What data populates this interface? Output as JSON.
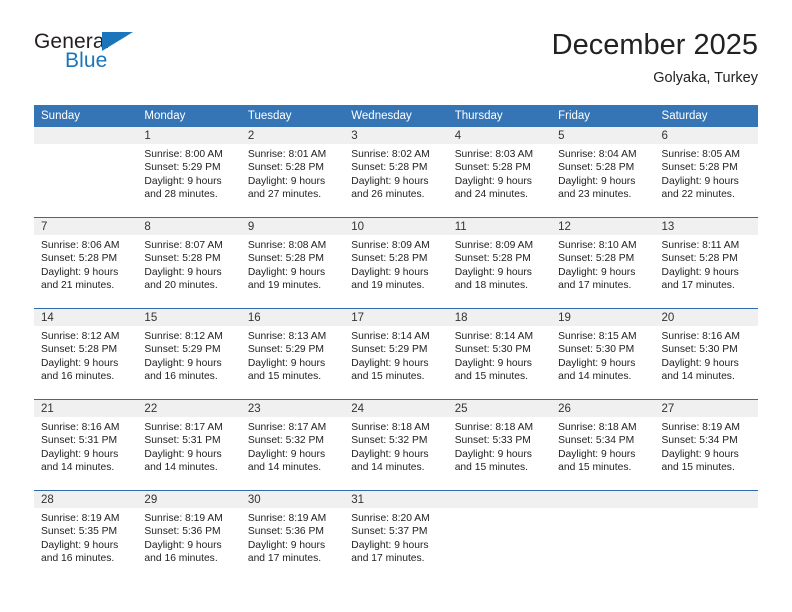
{
  "logo": {
    "word_one": "General",
    "word_two": "Blue",
    "flag_icon": "triangle-flag-icon"
  },
  "header": {
    "title": "December 2025",
    "subtitle": "Golyaka, Turkey"
  },
  "colors": {
    "header_blue": "#3575b5",
    "week_divider_blue": "#2d6cae",
    "daynum_band": "#f0f0f0",
    "logo_blue": "#1b75bb",
    "text": "#222222"
  },
  "calendar": {
    "weekday_headers": [
      "Sunday",
      "Monday",
      "Tuesday",
      "Wednesday",
      "Thursday",
      "Friday",
      "Saturday"
    ],
    "weeks": [
      [
        {
          "day": "",
          "lines": []
        },
        {
          "day": "1",
          "lines": [
            "Sunrise: 8:00 AM",
            "Sunset: 5:29 PM",
            "Daylight: 9 hours",
            "and 28 minutes."
          ]
        },
        {
          "day": "2",
          "lines": [
            "Sunrise: 8:01 AM",
            "Sunset: 5:28 PM",
            "Daylight: 9 hours",
            "and 27 minutes."
          ]
        },
        {
          "day": "3",
          "lines": [
            "Sunrise: 8:02 AM",
            "Sunset: 5:28 PM",
            "Daylight: 9 hours",
            "and 26 minutes."
          ]
        },
        {
          "day": "4",
          "lines": [
            "Sunrise: 8:03 AM",
            "Sunset: 5:28 PM",
            "Daylight: 9 hours",
            "and 24 minutes."
          ]
        },
        {
          "day": "5",
          "lines": [
            "Sunrise: 8:04 AM",
            "Sunset: 5:28 PM",
            "Daylight: 9 hours",
            "and 23 minutes."
          ]
        },
        {
          "day": "6",
          "lines": [
            "Sunrise: 8:05 AM",
            "Sunset: 5:28 PM",
            "Daylight: 9 hours",
            "and 22 minutes."
          ]
        }
      ],
      [
        {
          "day": "7",
          "lines": [
            "Sunrise: 8:06 AM",
            "Sunset: 5:28 PM",
            "Daylight: 9 hours",
            "and 21 minutes."
          ]
        },
        {
          "day": "8",
          "lines": [
            "Sunrise: 8:07 AM",
            "Sunset: 5:28 PM",
            "Daylight: 9 hours",
            "and 20 minutes."
          ]
        },
        {
          "day": "9",
          "lines": [
            "Sunrise: 8:08 AM",
            "Sunset: 5:28 PM",
            "Daylight: 9 hours",
            "and 19 minutes."
          ]
        },
        {
          "day": "10",
          "lines": [
            "Sunrise: 8:09 AM",
            "Sunset: 5:28 PM",
            "Daylight: 9 hours",
            "and 19 minutes."
          ]
        },
        {
          "day": "11",
          "lines": [
            "Sunrise: 8:09 AM",
            "Sunset: 5:28 PM",
            "Daylight: 9 hours",
            "and 18 minutes."
          ]
        },
        {
          "day": "12",
          "lines": [
            "Sunrise: 8:10 AM",
            "Sunset: 5:28 PM",
            "Daylight: 9 hours",
            "and 17 minutes."
          ]
        },
        {
          "day": "13",
          "lines": [
            "Sunrise: 8:11 AM",
            "Sunset: 5:28 PM",
            "Daylight: 9 hours",
            "and 17 minutes."
          ]
        }
      ],
      [
        {
          "day": "14",
          "lines": [
            "Sunrise: 8:12 AM",
            "Sunset: 5:28 PM",
            "Daylight: 9 hours",
            "and 16 minutes."
          ]
        },
        {
          "day": "15",
          "lines": [
            "Sunrise: 8:12 AM",
            "Sunset: 5:29 PM",
            "Daylight: 9 hours",
            "and 16 minutes."
          ]
        },
        {
          "day": "16",
          "lines": [
            "Sunrise: 8:13 AM",
            "Sunset: 5:29 PM",
            "Daylight: 9 hours",
            "and 15 minutes."
          ]
        },
        {
          "day": "17",
          "lines": [
            "Sunrise: 8:14 AM",
            "Sunset: 5:29 PM",
            "Daylight: 9 hours",
            "and 15 minutes."
          ]
        },
        {
          "day": "18",
          "lines": [
            "Sunrise: 8:14 AM",
            "Sunset: 5:30 PM",
            "Daylight: 9 hours",
            "and 15 minutes."
          ]
        },
        {
          "day": "19",
          "lines": [
            "Sunrise: 8:15 AM",
            "Sunset: 5:30 PM",
            "Daylight: 9 hours",
            "and 14 minutes."
          ]
        },
        {
          "day": "20",
          "lines": [
            "Sunrise: 8:16 AM",
            "Sunset: 5:30 PM",
            "Daylight: 9 hours",
            "and 14 minutes."
          ]
        }
      ],
      [
        {
          "day": "21",
          "lines": [
            "Sunrise: 8:16 AM",
            "Sunset: 5:31 PM",
            "Daylight: 9 hours",
            "and 14 minutes."
          ]
        },
        {
          "day": "22",
          "lines": [
            "Sunrise: 8:17 AM",
            "Sunset: 5:31 PM",
            "Daylight: 9 hours",
            "and 14 minutes."
          ]
        },
        {
          "day": "23",
          "lines": [
            "Sunrise: 8:17 AM",
            "Sunset: 5:32 PM",
            "Daylight: 9 hours",
            "and 14 minutes."
          ]
        },
        {
          "day": "24",
          "lines": [
            "Sunrise: 8:18 AM",
            "Sunset: 5:32 PM",
            "Daylight: 9 hours",
            "and 14 minutes."
          ]
        },
        {
          "day": "25",
          "lines": [
            "Sunrise: 8:18 AM",
            "Sunset: 5:33 PM",
            "Daylight: 9 hours",
            "and 15 minutes."
          ]
        },
        {
          "day": "26",
          "lines": [
            "Sunrise: 8:18 AM",
            "Sunset: 5:34 PM",
            "Daylight: 9 hours",
            "and 15 minutes."
          ]
        },
        {
          "day": "27",
          "lines": [
            "Sunrise: 8:19 AM",
            "Sunset: 5:34 PM",
            "Daylight: 9 hours",
            "and 15 minutes."
          ]
        }
      ],
      [
        {
          "day": "28",
          "lines": [
            "Sunrise: 8:19 AM",
            "Sunset: 5:35 PM",
            "Daylight: 9 hours",
            "and 16 minutes."
          ]
        },
        {
          "day": "29",
          "lines": [
            "Sunrise: 8:19 AM",
            "Sunset: 5:36 PM",
            "Daylight: 9 hours",
            "and 16 minutes."
          ]
        },
        {
          "day": "30",
          "lines": [
            "Sunrise: 8:19 AM",
            "Sunset: 5:36 PM",
            "Daylight: 9 hours",
            "and 17 minutes."
          ]
        },
        {
          "day": "31",
          "lines": [
            "Sunrise: 8:20 AM",
            "Sunset: 5:37 PM",
            "Daylight: 9 hours",
            "and 17 minutes."
          ]
        },
        {
          "day": "",
          "lines": []
        },
        {
          "day": "",
          "lines": []
        },
        {
          "day": "",
          "lines": []
        }
      ]
    ]
  }
}
